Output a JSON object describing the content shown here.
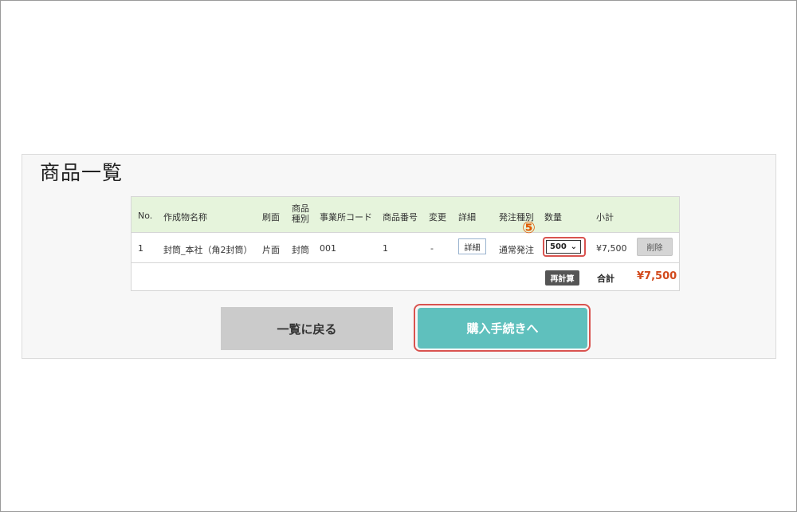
{
  "page": {
    "title": "商品一覧"
  },
  "table": {
    "headers": {
      "no": "No.",
      "name": "作成物名称",
      "print_side": "刷面",
      "product_type_line1": "商品",
      "product_type_line2": "種別",
      "office_code": "事業所コード",
      "product_number": "商品番号",
      "change": "変更",
      "detail": "詳細",
      "order_type": "発注種別",
      "quantity": "数量",
      "subtotal": "小計"
    },
    "rows": [
      {
        "no": "1",
        "name": "封筒_本社（角2封筒）",
        "print_side": "片面",
        "product_type": "封筒",
        "office_code": "001",
        "product_number": "1",
        "change": "-",
        "detail_button": "詳細",
        "order_type": "通常発注",
        "quantity": "500",
        "subtotal": "¥7,500",
        "delete_button": "削除"
      }
    ],
    "recalc_button": "再計算",
    "total_label": "合計",
    "total_value": "¥7,500"
  },
  "annotation": {
    "step_marker": "⑤"
  },
  "actions": {
    "back_label": "一覧に戻る",
    "purchase_label": "購入手続きへ"
  },
  "colors": {
    "header_bg": "#e6f4dc",
    "purchase_bg": "#5fc0bd",
    "highlight": "#d9534f",
    "total_color": "#d24a1c"
  }
}
